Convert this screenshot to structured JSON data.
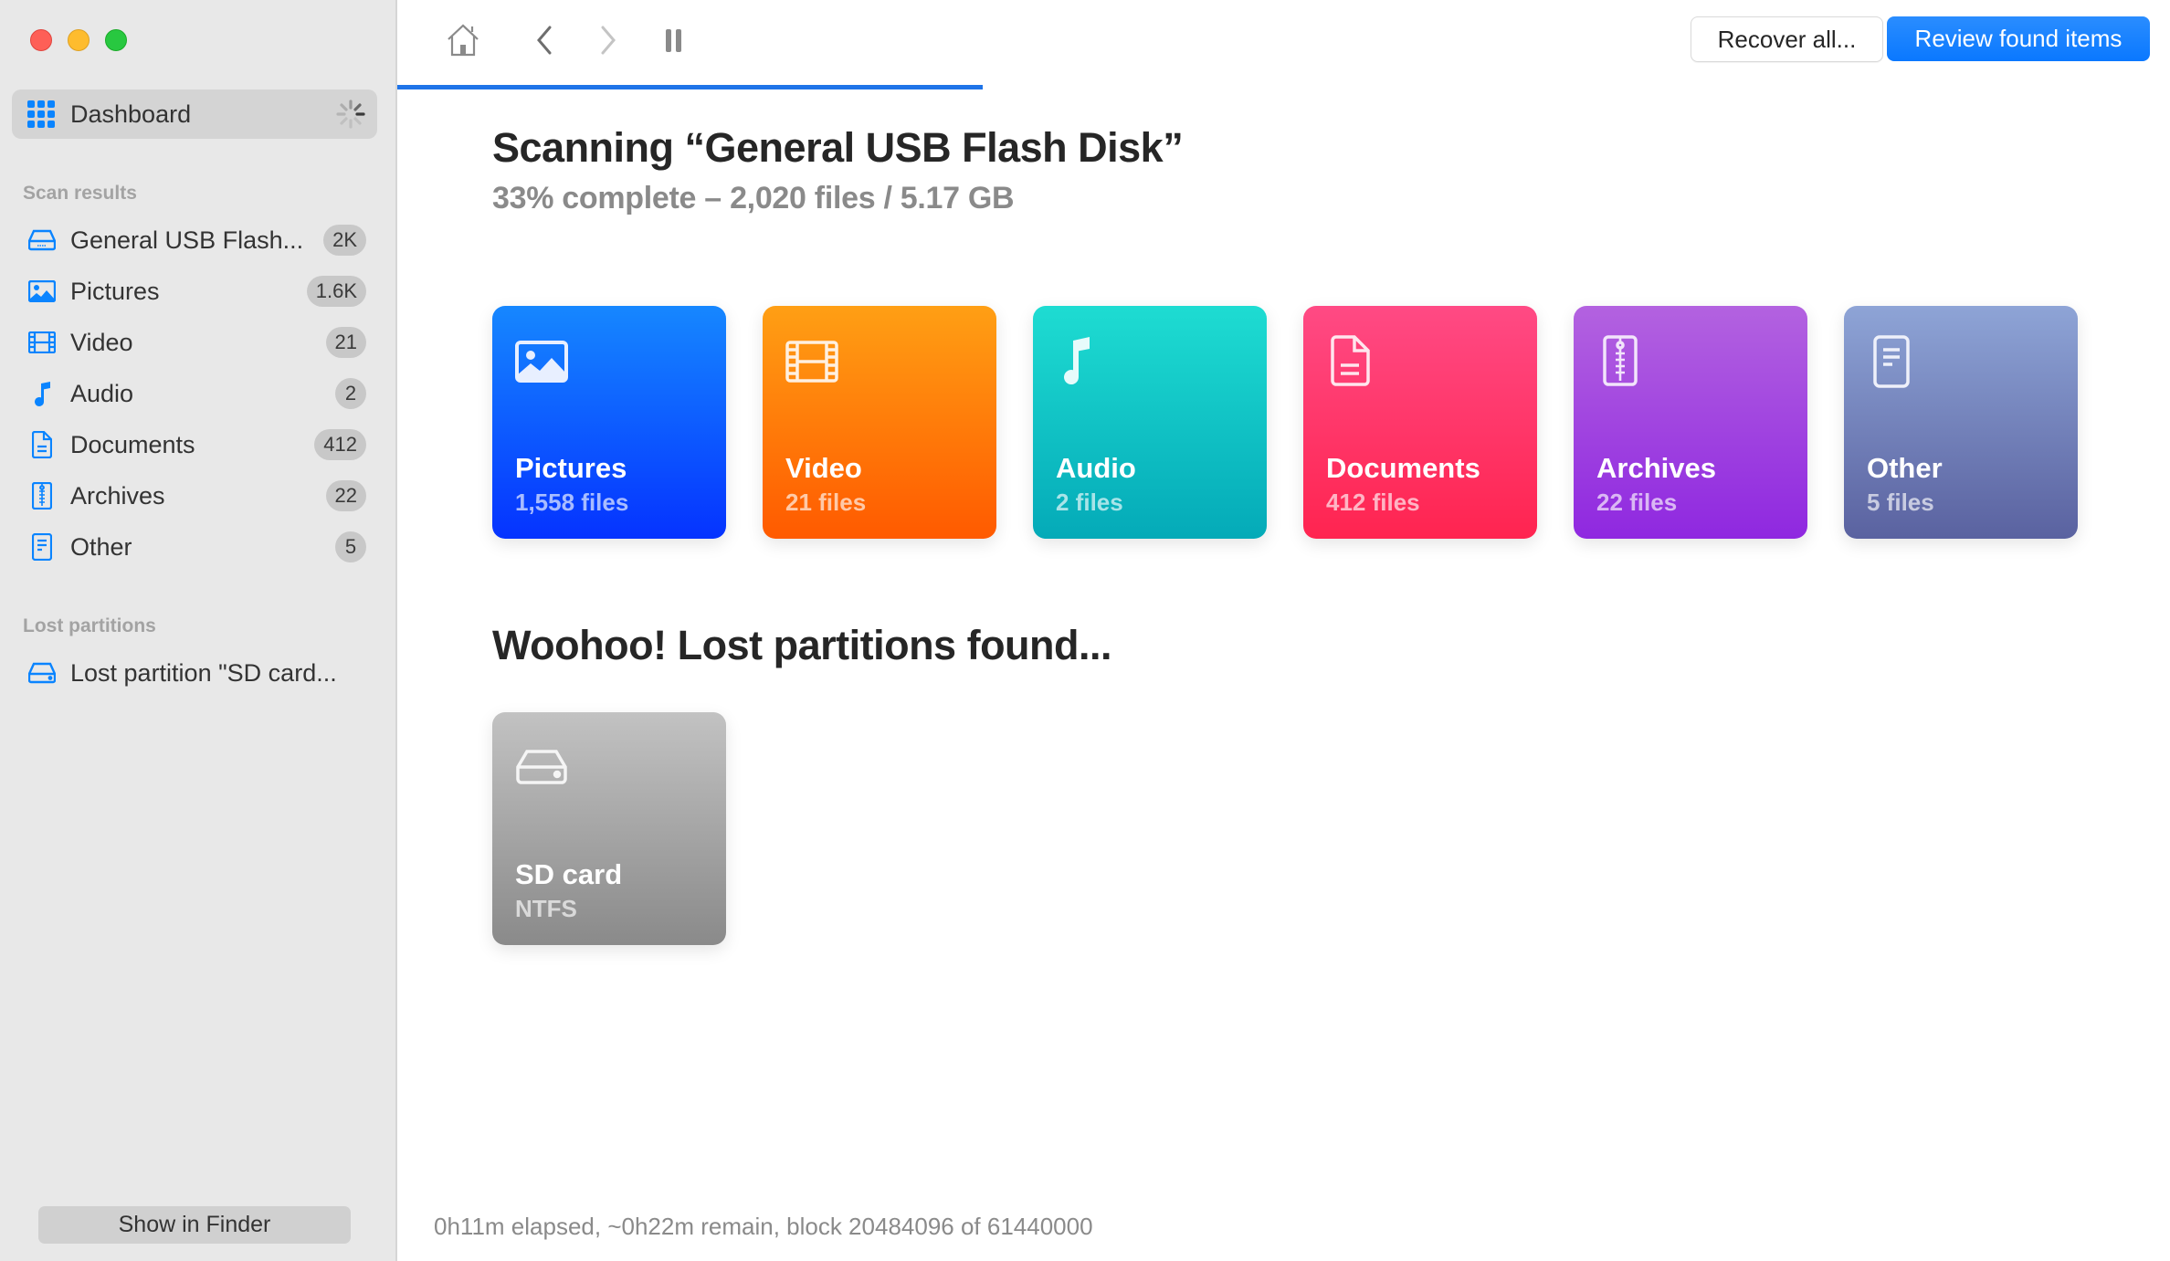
{
  "window": {
    "controls": [
      "close",
      "minimize",
      "maximize"
    ]
  },
  "sidebar": {
    "dashboard": {
      "label": "Dashboard",
      "icon": "grid-icon",
      "status_icon": "spinner-icon"
    },
    "scan_results_label": "Scan results",
    "scan_results": [
      {
        "label": "General USB Flash...",
        "badge": "2K",
        "icon": "drive-icon"
      },
      {
        "label": "Pictures",
        "badge": "1.6K",
        "icon": "picture-icon"
      },
      {
        "label": "Video",
        "badge": "21",
        "icon": "film-icon"
      },
      {
        "label": "Audio",
        "badge": "2",
        "icon": "music-note-icon"
      },
      {
        "label": "Documents",
        "badge": "412",
        "icon": "document-icon"
      },
      {
        "label": "Archives",
        "badge": "22",
        "icon": "archive-icon"
      },
      {
        "label": "Other",
        "badge": "5",
        "icon": "other-file-icon"
      }
    ],
    "lost_partitions_label": "Lost partitions",
    "lost_partitions": [
      {
        "label": "Lost partition \"SD card...",
        "icon": "drive-icon"
      }
    ],
    "show_in_finder": "Show in Finder"
  },
  "toolbar": {
    "home_icon": "home-icon",
    "back_icon": "chevron-left-icon",
    "forward_icon": "chevron-right-icon",
    "pause_icon": "pause-icon",
    "recover_all": "Recover all...",
    "review_found_items": "Review found items",
    "scan_progress_percent": 33,
    "accent_color": "#1f74e8"
  },
  "main": {
    "title": "Scanning “General USB Flash Disk”",
    "subtitle": "33% complete – 2,020 files / 5.17 GB",
    "categories": [
      {
        "name": "Pictures",
        "count": "1,558 files",
        "icon": "picture-icon",
        "color_top": "#1687ff",
        "color_bottom": "#0533ff"
      },
      {
        "name": "Video",
        "count": "21 files",
        "icon": "film-icon",
        "color_top": "#ff9f14",
        "color_bottom": "#ff5a00"
      },
      {
        "name": "Audio",
        "count": "2 files",
        "icon": "music-note-icon",
        "color_top": "#1edcd2",
        "color_bottom": "#04aab8"
      },
      {
        "name": "Documents",
        "count": "412 files",
        "icon": "document-icon",
        "color_top": "#ff4a84",
        "color_bottom": "#ff2450"
      },
      {
        "name": "Archives",
        "count": "22 files",
        "icon": "archive-icon",
        "color_top": "#b362e0",
        "color_bottom": "#8f28e0"
      },
      {
        "name": "Other",
        "count": "5 files",
        "icon": "other-file-icon",
        "color_top": "#8ea4d6",
        "color_bottom": "#5a62a0"
      }
    ],
    "lost_heading": "Woohoo! Lost partitions found...",
    "partitions": [
      {
        "name": "SD card",
        "fs": "NTFS",
        "icon": "drive-icon"
      }
    ],
    "status": "0h11m elapsed, ~0h22m remain, block 20484096 of 61440000"
  }
}
